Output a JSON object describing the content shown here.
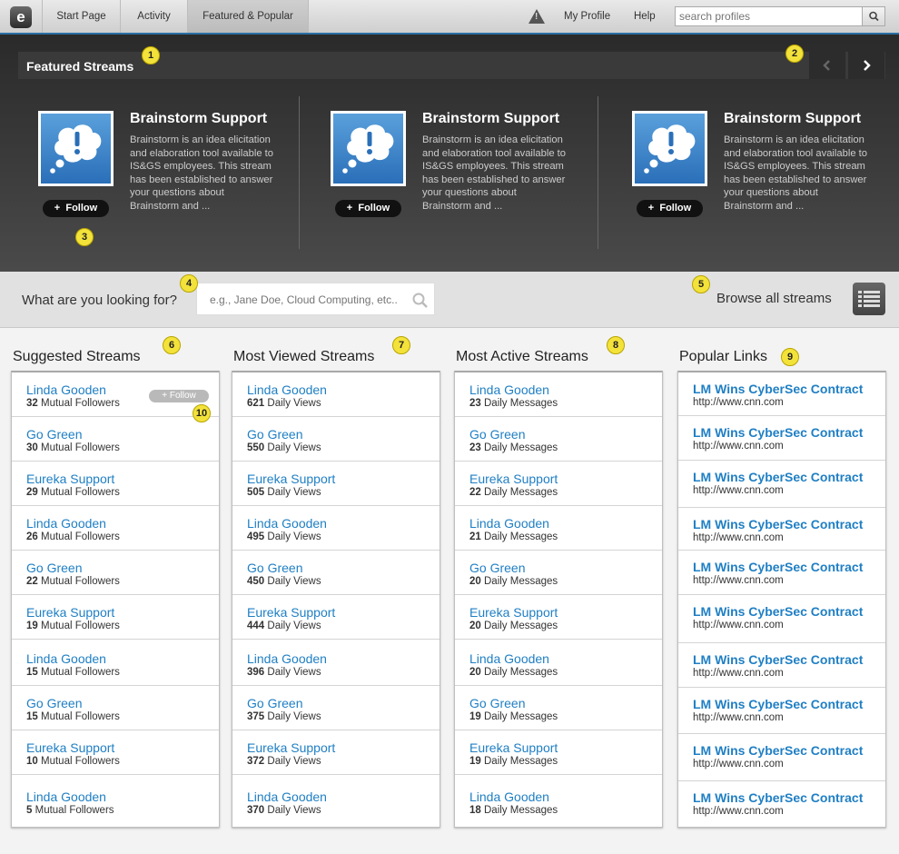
{
  "nav": {
    "logo": "e",
    "tabs": [
      "Start Page",
      "Activity",
      "Featured & Popular"
    ],
    "active_tab": "Featured & Popular",
    "alert_glyph": "!",
    "my_profile": "My Profile",
    "help": "Help",
    "search_placeholder": "search profiles"
  },
  "featured": {
    "title": "Featured Streams",
    "cards": [
      {
        "title": "Brainstorm Support",
        "description": "Brainstorm is an idea elicitation and elaboration tool available to IS&GS employees.  This stream has been established to answer your questions about Brainstorm and ...",
        "follow_label": "Follow"
      },
      {
        "title": "Brainstorm Support",
        "description": "Brainstorm is an idea elicitation and elaboration tool available to IS&GS employees.  This stream has been established to answer your questions about Brainstorm and ...",
        "follow_label": "Follow"
      },
      {
        "title": "Brainstorm Support",
        "description": "Brainstorm is an idea elicitation and elaboration tool available to IS&GS employees.  This stream has been established to answer your questions about Brainstorm and ...",
        "follow_label": "Follow"
      }
    ]
  },
  "search": {
    "label": "What are you looking for?",
    "placeholder": "e.g., Jane Doe, Cloud Computing, etc..",
    "browse_label": "Browse all streams"
  },
  "markers": [
    "1",
    "2",
    "3",
    "4",
    "5",
    "6",
    "7",
    "8",
    "9",
    "10"
  ],
  "suggested": {
    "title": "Suggested Streams",
    "follow_label": "Follow",
    "unit": "Mutual Followers",
    "rows": [
      {
        "name": "Linda Gooden",
        "count": "32"
      },
      {
        "name": "Go Green",
        "count": "30"
      },
      {
        "name": "Eureka Support",
        "count": "29"
      },
      {
        "name": "Linda Gooden",
        "count": "26"
      },
      {
        "name": "Go Green",
        "count": "22"
      },
      {
        "name": "Eureka Support",
        "count": "19"
      },
      {
        "name": "Linda Gooden",
        "count": "15"
      },
      {
        "name": "Go Green",
        "count": "15"
      },
      {
        "name": "Eureka Support",
        "count": "10"
      },
      {
        "name": "Linda Gooden",
        "count": "5"
      }
    ]
  },
  "most_viewed": {
    "title": "Most Viewed Streams",
    "unit": "Daily Views",
    "rows": [
      {
        "name": "Linda Gooden",
        "count": "621"
      },
      {
        "name": "Go Green",
        "count": "550"
      },
      {
        "name": "Eureka Support",
        "count": "505"
      },
      {
        "name": "Linda Gooden",
        "count": "495"
      },
      {
        "name": "Go Green",
        "count": "450"
      },
      {
        "name": "Eureka Support",
        "count": "444"
      },
      {
        "name": "Linda Gooden",
        "count": "396"
      },
      {
        "name": "Go Green",
        "count": "375"
      },
      {
        "name": "Eureka Support",
        "count": "372"
      },
      {
        "name": "Linda Gooden",
        "count": "370"
      }
    ]
  },
  "most_active": {
    "title": "Most Active Streams",
    "unit": "Daily Messages",
    "rows": [
      {
        "name": "Linda Gooden",
        "count": "23"
      },
      {
        "name": "Go Green",
        "count": "23"
      },
      {
        "name": "Eureka Support",
        "count": "22"
      },
      {
        "name": "Linda Gooden",
        "count": "21"
      },
      {
        "name": "Go Green",
        "count": "20"
      },
      {
        "name": "Eureka Support",
        "count": "20"
      },
      {
        "name": "Linda Gooden",
        "count": "20"
      },
      {
        "name": "Go Green",
        "count": "19"
      },
      {
        "name": "Eureka Support",
        "count": "19"
      },
      {
        "name": "Linda Gooden",
        "count": "18"
      }
    ]
  },
  "popular_links": {
    "title": "Popular Links",
    "rows": [
      {
        "title": "LM Wins CyberSec Contract",
        "url": "http://www.cnn.com"
      },
      {
        "title": "LM Wins CyberSec Contract",
        "url": "http://www.cnn.com"
      },
      {
        "title": "LM Wins CyberSec Contract",
        "url": "http://www.cnn.com"
      },
      {
        "title": "LM Wins CyberSec Contract",
        "url": "http://www.cnn.com"
      },
      {
        "title": "LM Wins CyberSec Contract",
        "url": "http://www.cnn.com"
      },
      {
        "title": "LM Wins CyberSec Contract",
        "url": "http://www.cnn.com"
      },
      {
        "title": "LM Wins CyberSec Contract",
        "url": "http://www.cnn.com"
      },
      {
        "title": "LM Wins CyberSec Contract",
        "url": "http://www.cnn.com"
      },
      {
        "title": "LM Wins CyberSec Contract",
        "url": "http://www.cnn.com"
      },
      {
        "title": "LM Wins CyberSec Contract",
        "url": "http://www.cnn.com"
      }
    ]
  },
  "colors": {
    "link": "#1f7fc4",
    "marker": "#f3e23a",
    "accent": "#2a6fa5"
  }
}
